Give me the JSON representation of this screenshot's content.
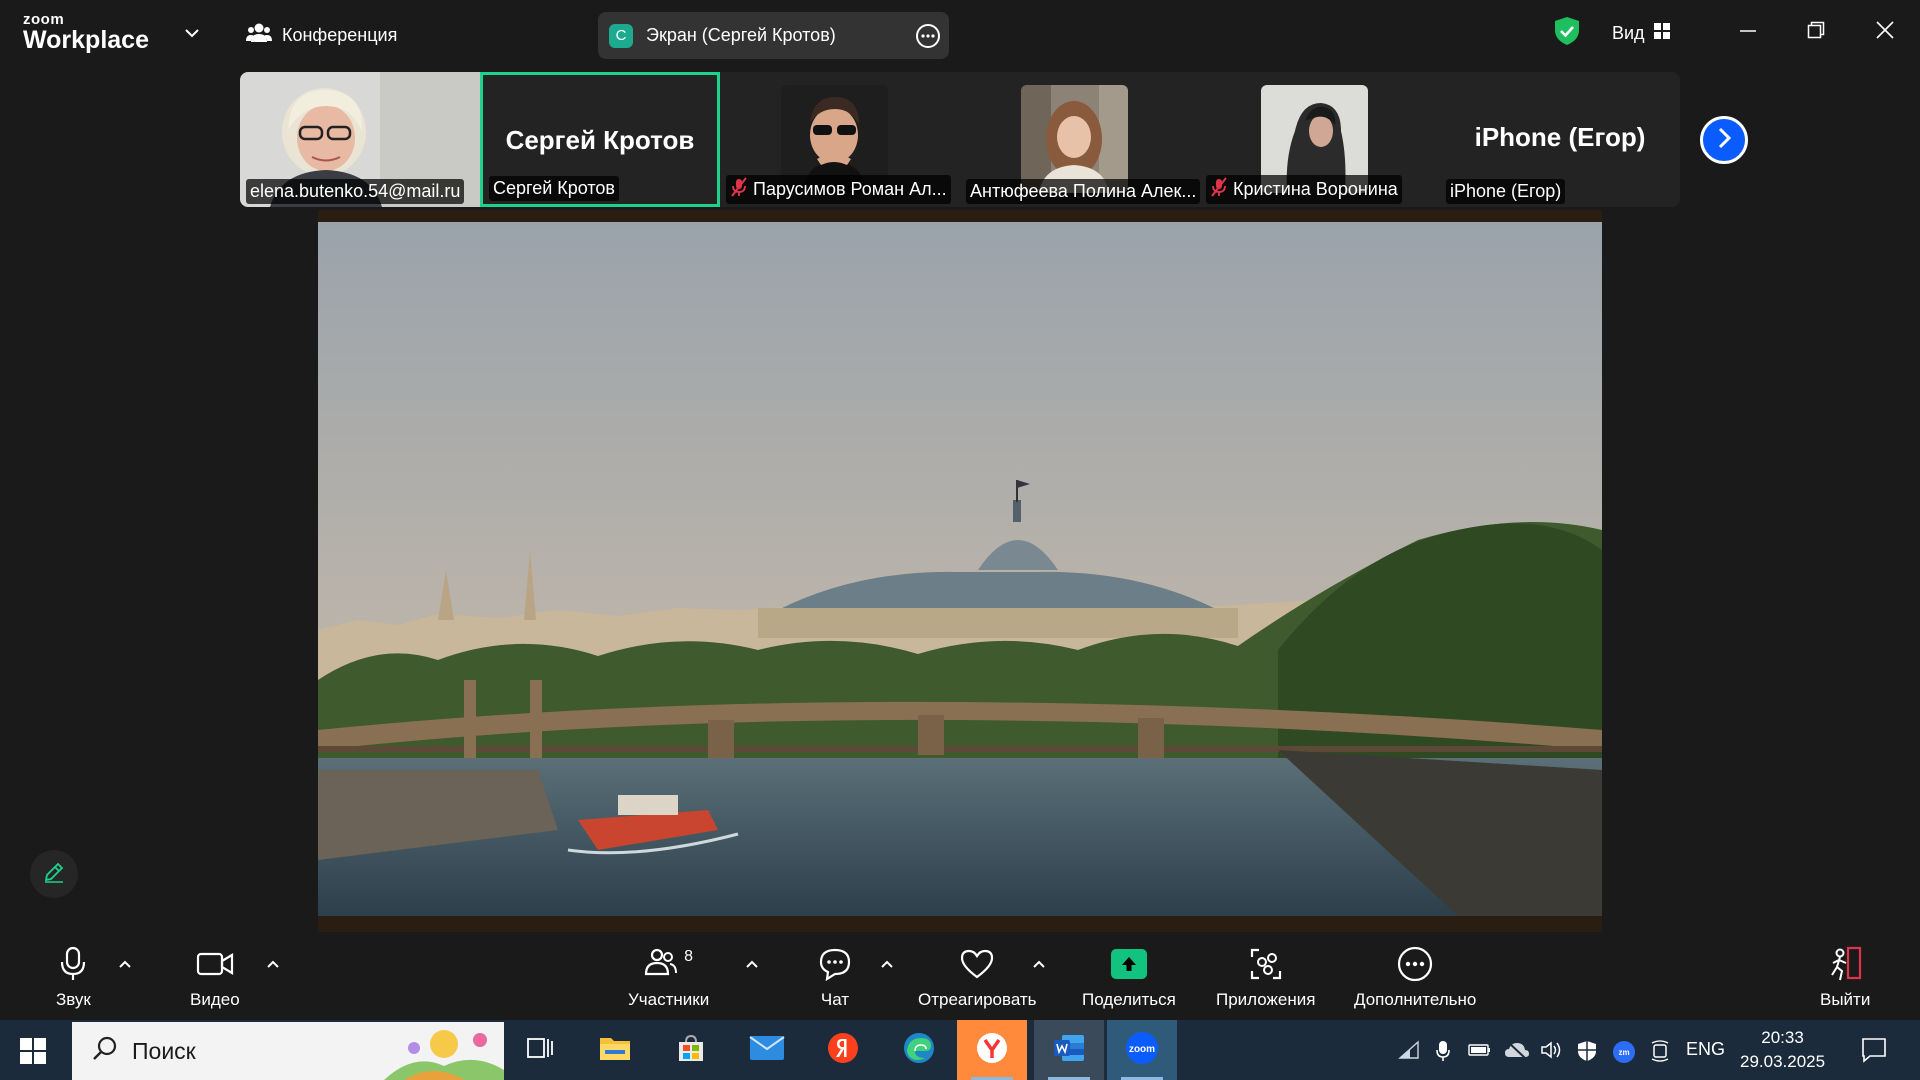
{
  "app": {
    "logo_top": "zoom",
    "logo_bottom": "Workplace"
  },
  "header": {
    "meeting_label": "Конференция",
    "screen_share": {
      "avatar_letter": "С",
      "label": "Экран (Сергей Кротов)"
    },
    "view_label": "Вид"
  },
  "gallery": {
    "tiles": [
      {
        "name": "elena.butenko.54@mail.ru",
        "big_name": "",
        "muted": false,
        "video": true
      },
      {
        "name": "Сергей Кротов",
        "big_name": "Сергей Кротов",
        "muted": false,
        "video": false,
        "active": true
      },
      {
        "name": "Парусимов Роман Ал...",
        "big_name": "",
        "muted": true,
        "video": true
      },
      {
        "name": "Антюфеева Полина Алек...",
        "big_name": "",
        "muted": false,
        "video": true
      },
      {
        "name": "Кристина Воронина",
        "big_name": "",
        "muted": true,
        "video": true
      },
      {
        "name": "iPhone (Егор)",
        "big_name": "iPhone (Егор)",
        "muted": false,
        "video": false
      }
    ]
  },
  "toolbar": {
    "audio": "Звук",
    "video": "Видео",
    "participants": "Участники",
    "participants_count": "8",
    "chat": "Чат",
    "react": "Отреагировать",
    "share": "Поделиться",
    "apps": "Приложения",
    "more": "Дополнительно",
    "leave": "Выйти"
  },
  "taskbar": {
    "search_placeholder": "Поиск",
    "lang": "ENG",
    "time": "20:33",
    "date": "29.03.2025"
  },
  "colors": {
    "accent_green": "#1ed18c",
    "zoom_blue": "#0b5cff",
    "share_green": "#12c27f",
    "bg": "#1a1a1a",
    "taskbar": "#1c2b3b"
  }
}
